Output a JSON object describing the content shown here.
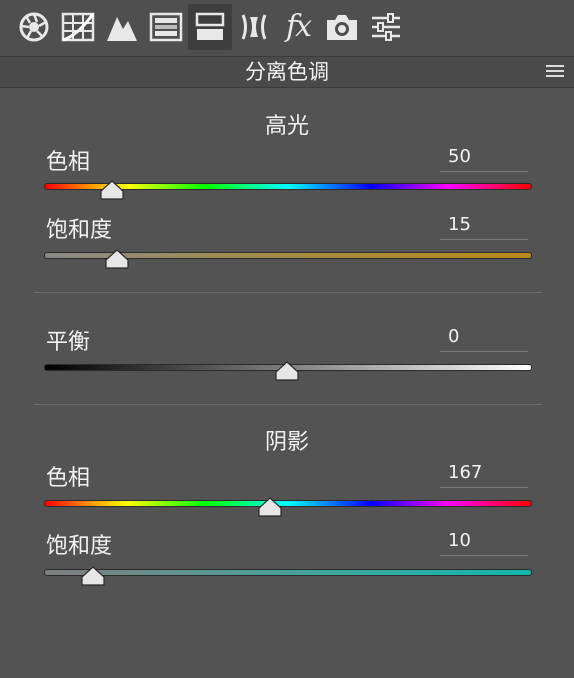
{
  "panel": {
    "title": "分离色调"
  },
  "toolbar": {
    "tools": [
      {
        "icon": "basic-aperture-icon"
      },
      {
        "icon": "tone-curve-grid-icon"
      },
      {
        "icon": "detail-mountain-icon"
      },
      {
        "icon": "hsl-panel-icon"
      },
      {
        "icon": "split-toning-icon",
        "active": true
      },
      {
        "icon": "lens-correction-icon"
      },
      {
        "icon": "fx-icon",
        "glyph": "fx"
      },
      {
        "icon": "camera-calibration-icon"
      },
      {
        "icon": "presets-sliders-icon"
      }
    ]
  },
  "highlights": {
    "title": "高光",
    "hue": {
      "label": "色相",
      "value": "50",
      "fraction": 0.139
    },
    "saturation": {
      "label": "饱和度",
      "value": "15",
      "fraction": 0.15
    }
  },
  "balance": {
    "label": "平衡",
    "value": "0",
    "fraction": 0.5
  },
  "shadows": {
    "title": "阴影",
    "hue": {
      "label": "色相",
      "value": "167",
      "fraction": 0.464
    },
    "saturation": {
      "label": "饱和度",
      "value": "10",
      "fraction": 0.1
    }
  }
}
